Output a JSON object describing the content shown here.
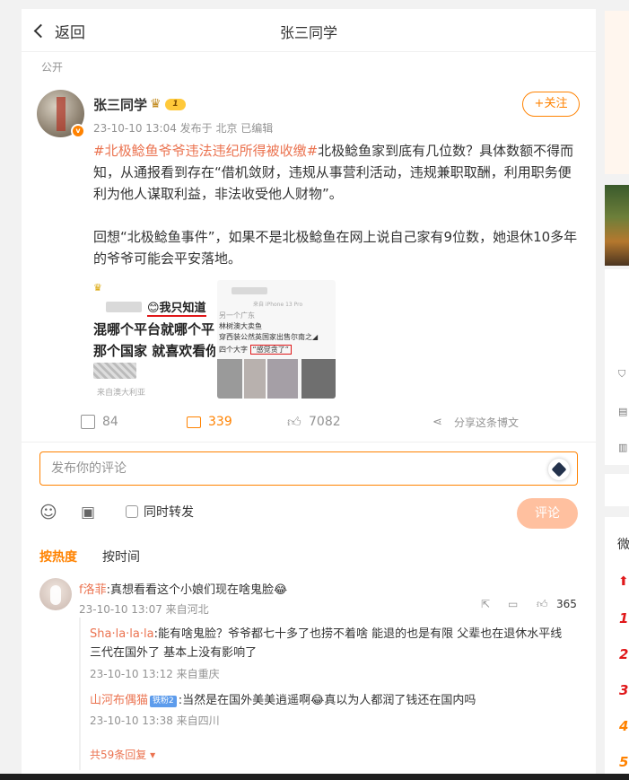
{
  "topbar": {
    "back_label": "返回",
    "title": "张三同学"
  },
  "post": {
    "visibility": "公开",
    "author": "张三同学",
    "level": "1",
    "meta": "23-10-10 13:04  发布于 北京  已编辑",
    "follow_label": "+关注",
    "topic": "#北极鲶鱼爷爷违法违纪所得被收缴#",
    "paragraph1_rest": "北极鲶鱼家到底有几位数？具体数额不得而知，从通报看到存在“借机敛财，违规从事营利活动，违规兼职取酬，利用职务便利为他人谋取利益，非法收受他人财物”。",
    "paragraph2": "回想“北极鲶鱼事件”，如果不是北极鲶鱼在网上说自己家有9位数，她退休10多年的爷爷可能会平安落地。",
    "image1": {
      "line1": "😊我只知道",
      "line2": "混哪个平台就哪个平",
      "line3": "那个国家 就喜欢看你",
      "footer": "来自澳大利亚"
    },
    "image2": {
      "header": "来自 iPhone 13 Pro",
      "sub": "另一个广东",
      "line1": "林树澳大卖鱼",
      "line2": "穿西装公然英国家出售尔南之◢",
      "line3_pre": "四个大字",
      "line3_boxed": "“感觉贪了”"
    }
  },
  "actions": {
    "share_count": "84",
    "comment_count": "339",
    "like_count": "7082",
    "share_post_label": "分享这条博文"
  },
  "comment_box": {
    "placeholder": "发布你的评论",
    "forward_label": "同时转发",
    "submit_label": "评论"
  },
  "sort": {
    "hot": "按热度",
    "time": "按时间"
  },
  "comments": [
    {
      "name": "f洛菲",
      "text": ":真想看看这个小娘们现在啥鬼脸😂",
      "meta": "23-10-10 13:07  来自河北",
      "likes": "365",
      "replies": [
        {
          "name": "Sha·la·la·la",
          "text": ":能有啥鬼脸？爷爷都七十多了也捞不着啥 能退的也是有限  父辈也在退休水平线  三代在国外了  基本上没有影响了",
          "meta": "23-10-10 13:12  来自重庆"
        },
        {
          "name": "山河布偶猫",
          "badge": "铁粉2",
          "text": ":当然是在国外美美逍遥啊😂真以为人都润了钱还在国内吗",
          "meta": "23-10-10 13:38  来自四川"
        }
      ],
      "more_label": "共59条回复"
    }
  ],
  "right_panel": {
    "heading_char": "微",
    "ranks": [
      "1",
      "2",
      "3",
      "4",
      "5"
    ]
  }
}
